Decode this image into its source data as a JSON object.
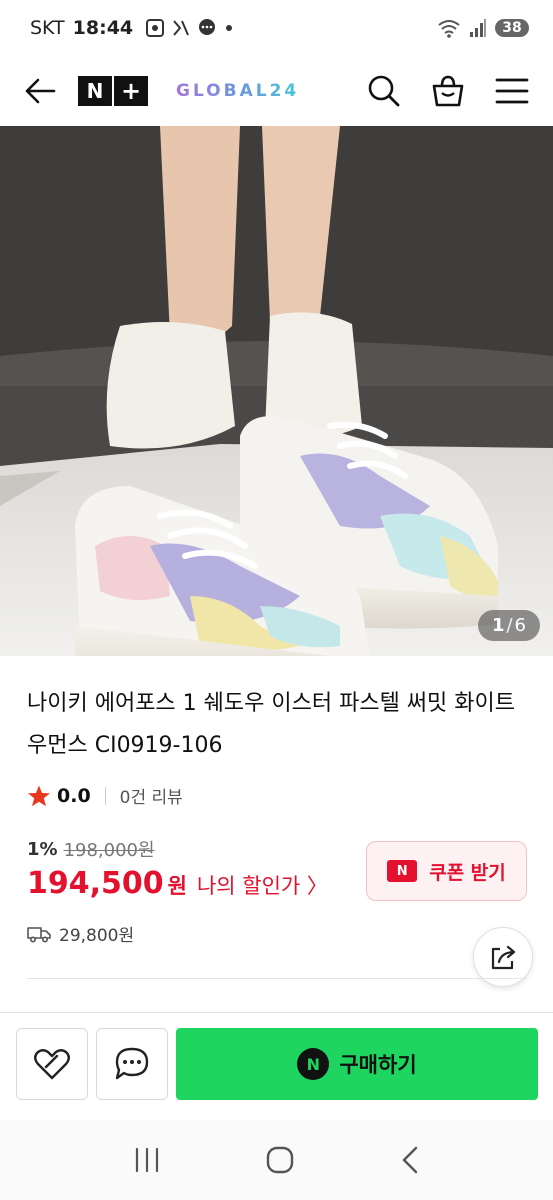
{
  "status_bar": {
    "carrier": "SKT",
    "time": "18:44",
    "battery": "38"
  },
  "header": {
    "logo_n": "N",
    "logo_plus": "+",
    "brand": "GLOBAL24"
  },
  "gallery": {
    "current": "1",
    "separator": "/",
    "total": "6"
  },
  "product": {
    "title": "나이키 에어포스 1 쉐도우 이스터 파스텔 써밋 화이트 우먼스 CI0919-106",
    "rating": "0.0",
    "review_count": "0건 리뷰",
    "discount_pct": "1%",
    "original_price": "198,000원",
    "price": "194,500",
    "price_unit": "원",
    "my_discount": "나의 할인가 〉",
    "coupon_badge": "N",
    "coupon_label": "쿠폰 받기",
    "shipping": "29,800원"
  },
  "actions": {
    "buy_badge": "N",
    "buy_label": "구매하기"
  },
  "colors": {
    "accent_red": "#e3102e",
    "buy_green": "#1ed65f"
  }
}
